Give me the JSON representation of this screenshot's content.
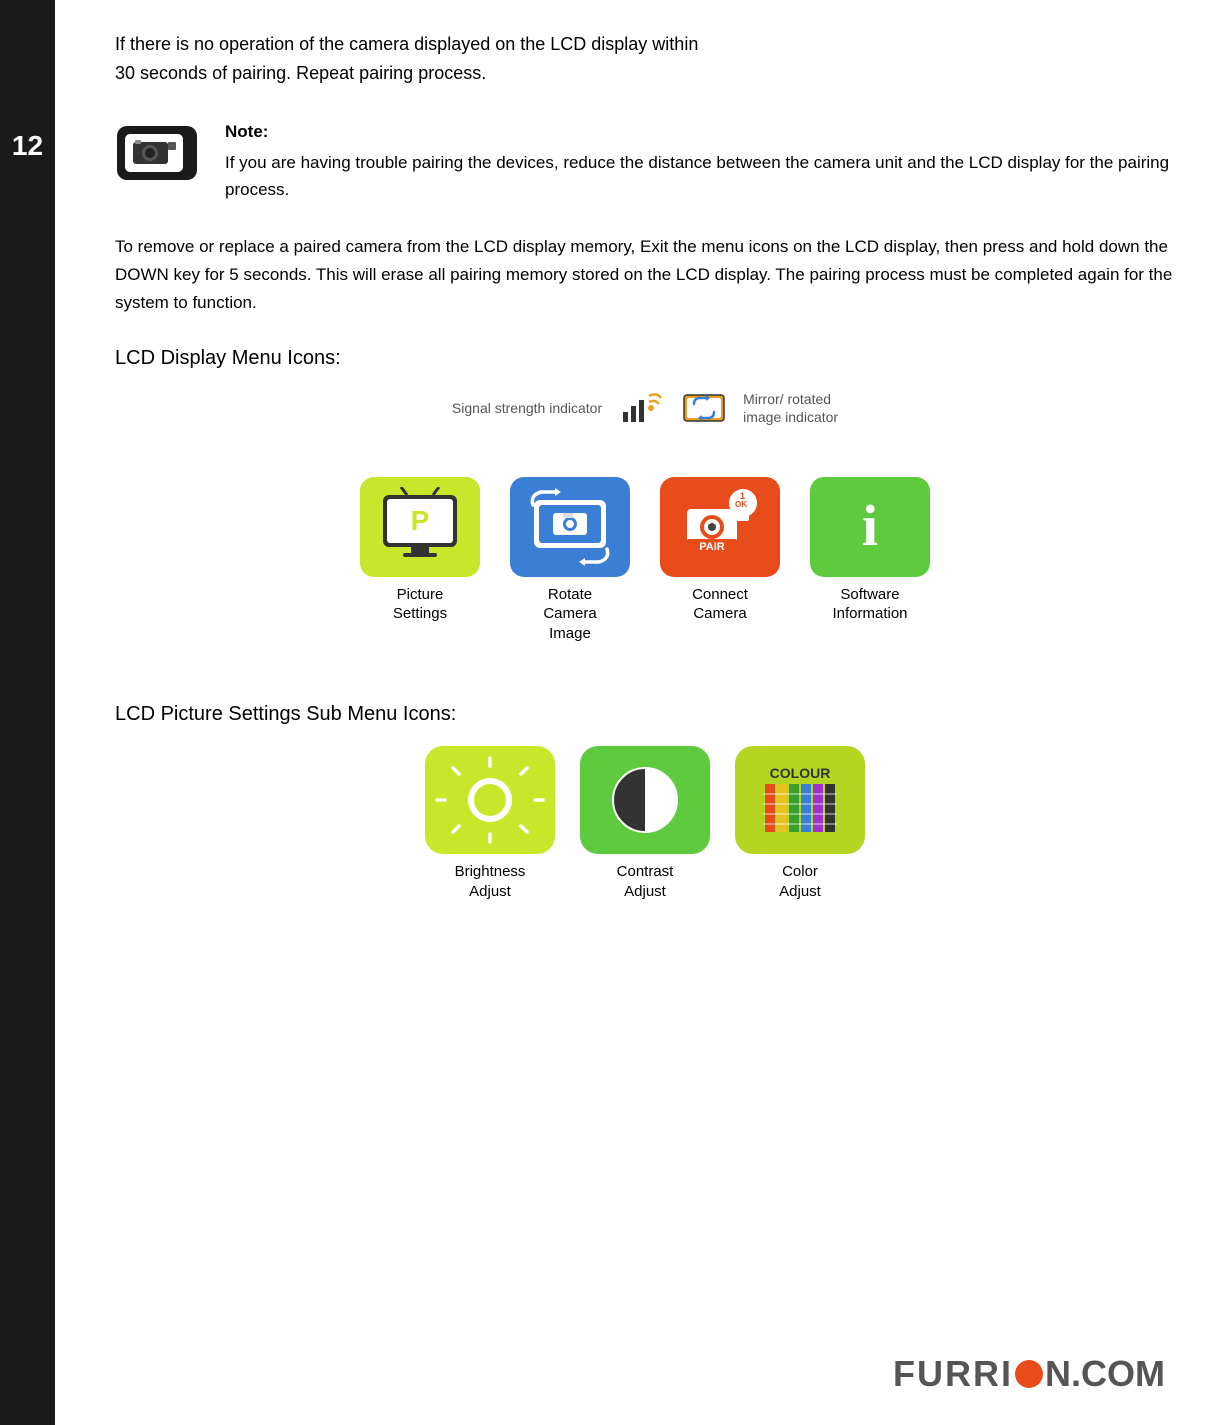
{
  "sidebar": {
    "page_number": "12"
  },
  "intro": {
    "line1": "If there is no operation of the camera displayed on the LCD display within",
    "line2": "30 seconds of pairing.  Repeat pairing process."
  },
  "note": {
    "title": "Note:",
    "body": "If you are having trouble pairing the devices, reduce the distance between the camera unit and the LCD display for the pairing process."
  },
  "para2": {
    "text": "To remove or replace a paired camera from the LCD display memory, Exit the menu icons on the LCD display, then press and hold down the DOWN key for 5 seconds. This will erase all pairing memory stored on the LCD display.  The pairing process must be completed again for the system to function."
  },
  "lcd_menu_heading": "LCD Display Menu Icons:",
  "signal_label": "Signal strength indicator",
  "mirror_label": "Mirror/ rotated\nimage indicator",
  "menu_icons": [
    {
      "label": "Picture\nSettings",
      "color_class": "icon-picture-settings",
      "icon_type": "picture"
    },
    {
      "label": "Rotate\nCamera\nImage",
      "color_class": "icon-rotate-camera",
      "icon_type": "rotate"
    },
    {
      "label": "Connect\nCamera",
      "color_class": "icon-connect-camera",
      "icon_type": "connect"
    },
    {
      "label": "Software\nInformation",
      "color_class": "icon-software-info",
      "icon_type": "info"
    }
  ],
  "lcd_sub_heading": "LCD Picture Settings Sub Menu Icons:",
  "sub_icons": [
    {
      "label": "Brightness\nAdjust",
      "color_class": "sub-icon-brightness",
      "icon_type": "brightness"
    },
    {
      "label": "Contrast\nAdjust",
      "color_class": "sub-icon-contrast",
      "icon_type": "contrast"
    },
    {
      "label": "Color\nAdjust",
      "color_class": "sub-icon-color",
      "icon_type": "colour"
    }
  ],
  "footer": {
    "brand": "FURRI",
    "circle": "O",
    "domain": "N.COM"
  }
}
